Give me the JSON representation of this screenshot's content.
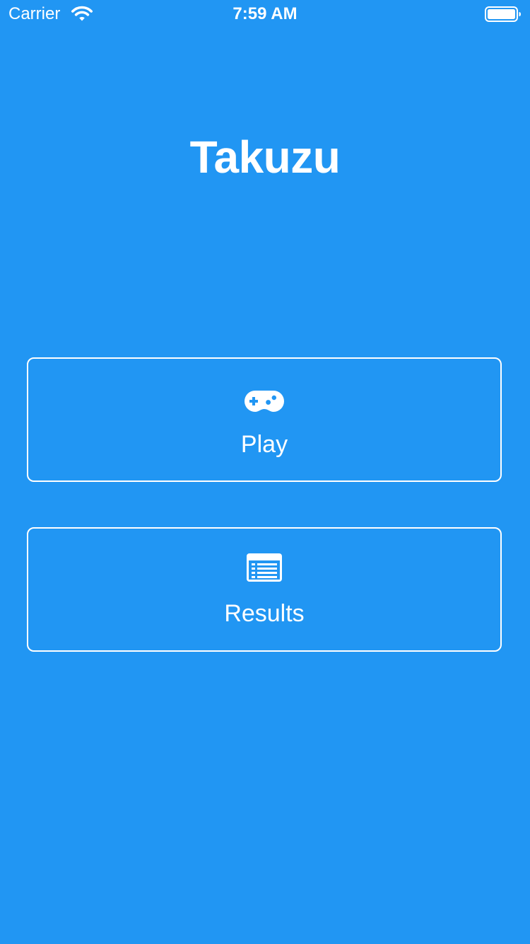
{
  "status_bar": {
    "carrier": "Carrier",
    "time": "7:59 AM",
    "wifi_icon": "wifi-icon",
    "battery_icon": "battery-full-icon"
  },
  "app": {
    "title": "Takuzu"
  },
  "menu": {
    "play": {
      "label": "Play",
      "icon": "gamepad-icon"
    },
    "results": {
      "label": "Results",
      "icon": "list-icon"
    }
  },
  "colors": {
    "background": "#2196F3",
    "foreground": "#FFFFFF"
  }
}
